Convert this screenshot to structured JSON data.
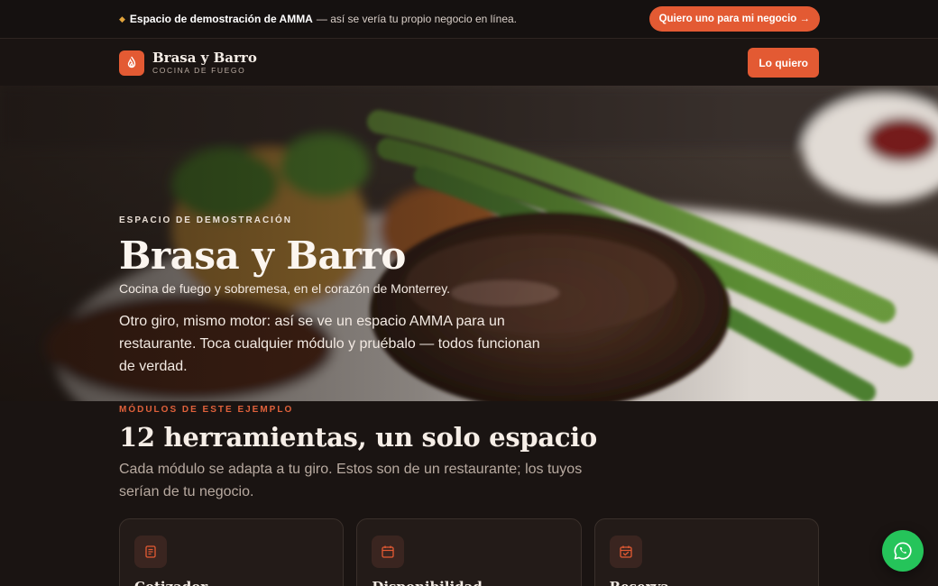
{
  "demo_bar": {
    "strong": "Espacio de demostración de AMMA",
    "rest": "— así se vería tu propio negocio en línea.",
    "cta": "Quiero uno para mi negocio →"
  },
  "header": {
    "brand_name": "Brasa y Barro",
    "brand_tag": "COCINA DE FUEGO",
    "cta": "Lo quiero"
  },
  "hero": {
    "eyebrow": "ESPACIO DE DEMOSTRACIÓN",
    "title": "Brasa y Barro",
    "subtitle": "Cocina de fuego y sobremesa, en el corazón de Monterrey.",
    "description": "Otro giro, mismo motor: así se ve un espacio AMMA para un restaurante. Toca cualquier módulo y pruébalo — todos funcionan de verdad."
  },
  "modules": {
    "kicker": "MÓDULOS DE ESTE EJEMPLO",
    "title": "12 herramientas, un solo espacio",
    "lede": "Cada módulo se adapta a tu giro. Estos son de un restaurante; los tuyos serían de tu negocio.",
    "cards": [
      {
        "title": "Cotizador",
        "icon": "receipt-icon"
      },
      {
        "title": "Disponibilidad",
        "icon": "calendar-icon"
      },
      {
        "title": "Reserva",
        "icon": "calendar-check-icon"
      }
    ]
  },
  "colors": {
    "accent": "#e35a33",
    "background": "#1a1412",
    "whatsapp": "#25c45a"
  }
}
